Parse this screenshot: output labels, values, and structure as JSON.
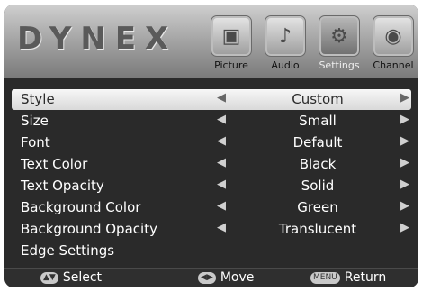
{
  "header": {
    "logo": "DYNEX",
    "tabs": [
      {
        "label": "Picture",
        "icon": "picture-icon",
        "active": false
      },
      {
        "label": "Audio",
        "icon": "audio-icon",
        "active": false
      },
      {
        "label": "Settings",
        "icon": "settings-icon",
        "active": true
      },
      {
        "label": "Channel",
        "icon": "channel-icon",
        "active": false
      }
    ]
  },
  "menu": {
    "items": [
      {
        "label": "Style",
        "value": "Custom",
        "selected": true
      },
      {
        "label": "Size",
        "value": "Small"
      },
      {
        "label": "Font",
        "value": "Default"
      },
      {
        "label": "Text Color",
        "value": "Black"
      },
      {
        "label": "Text Opacity",
        "value": "Solid"
      },
      {
        "label": "Background Color",
        "value": "Green"
      },
      {
        "label": "Background Opacity",
        "value": "Translucent"
      },
      {
        "label": "Edge Settings",
        "value": ""
      }
    ]
  },
  "footer": {
    "select_label": "Select",
    "move_label": "Move",
    "menu_key": "MENU",
    "return_label": "Return"
  }
}
